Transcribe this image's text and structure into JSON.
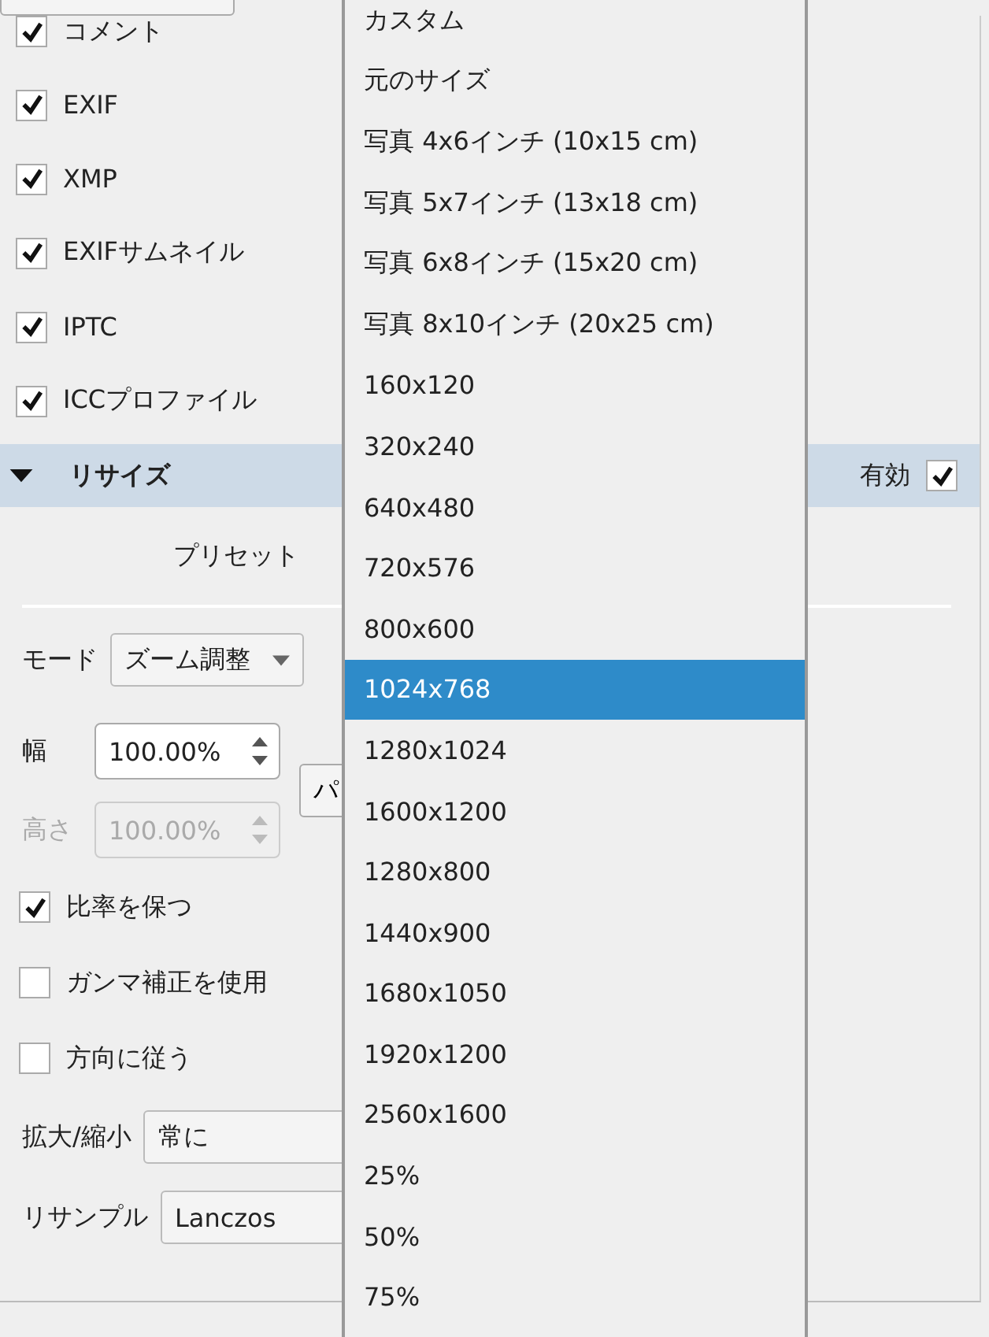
{
  "metadata": {
    "items": [
      {
        "label": "コメント",
        "checked": true
      },
      {
        "label": "EXIF",
        "checked": true
      },
      {
        "label": "XMP",
        "checked": true
      },
      {
        "label": "EXIFサムネイル",
        "checked": true
      },
      {
        "label": "IPTC",
        "checked": true
      },
      {
        "label": "ICCプロファイル",
        "checked": true
      }
    ]
  },
  "resize": {
    "title": "リサイズ",
    "expanded": true,
    "enabled_label": "有効",
    "enabled": true,
    "preset_label": "プリセット",
    "mode_label": "モード",
    "mode_value": "ズーム調整",
    "width_label": "幅",
    "width_value": "100.00%",
    "width_disabled": false,
    "height_label": "高さ",
    "height_value": "100.00%",
    "height_disabled": true,
    "side_button": "パ",
    "options": [
      {
        "label": "比率を保つ",
        "checked": true
      },
      {
        "label": "ガンマ補正を使用",
        "checked": false
      },
      {
        "label": "方向に従う",
        "checked": false
      }
    ],
    "scale_label": "拡大/縮小",
    "scale_value": "常に",
    "resample_label": "リサンプル",
    "resample_value": "Lanczos"
  },
  "preset_dropdown": {
    "items": [
      {
        "label": "カスタム",
        "selected": false
      },
      {
        "label": "元のサイズ",
        "selected": false
      },
      {
        "label": "写真 4x6インチ (10x15 cm)",
        "selected": false
      },
      {
        "label": "写真 5x7インチ (13x18 cm)",
        "selected": false
      },
      {
        "label": "写真 6x8インチ (15x20 cm)",
        "selected": false
      },
      {
        "label": "写真 8x10インチ (20x25 cm)",
        "selected": false
      },
      {
        "label": "160x120",
        "selected": false
      },
      {
        "label": "320x240",
        "selected": false
      },
      {
        "label": "640x480",
        "selected": false
      },
      {
        "label": "720x576",
        "selected": false
      },
      {
        "label": "800x600",
        "selected": false
      },
      {
        "label": "1024x768",
        "selected": true
      },
      {
        "label": "1280x1024",
        "selected": false
      },
      {
        "label": "1600x1200",
        "selected": false
      },
      {
        "label": "1280x800",
        "selected": false
      },
      {
        "label": "1440x900",
        "selected": false
      },
      {
        "label": "1680x1050",
        "selected": false
      },
      {
        "label": "1920x1200",
        "selected": false
      },
      {
        "label": "2560x1600",
        "selected": false
      },
      {
        "label": "25%",
        "selected": false
      },
      {
        "label": "50%",
        "selected": false
      },
      {
        "label": "75%",
        "selected": false
      }
    ]
  }
}
